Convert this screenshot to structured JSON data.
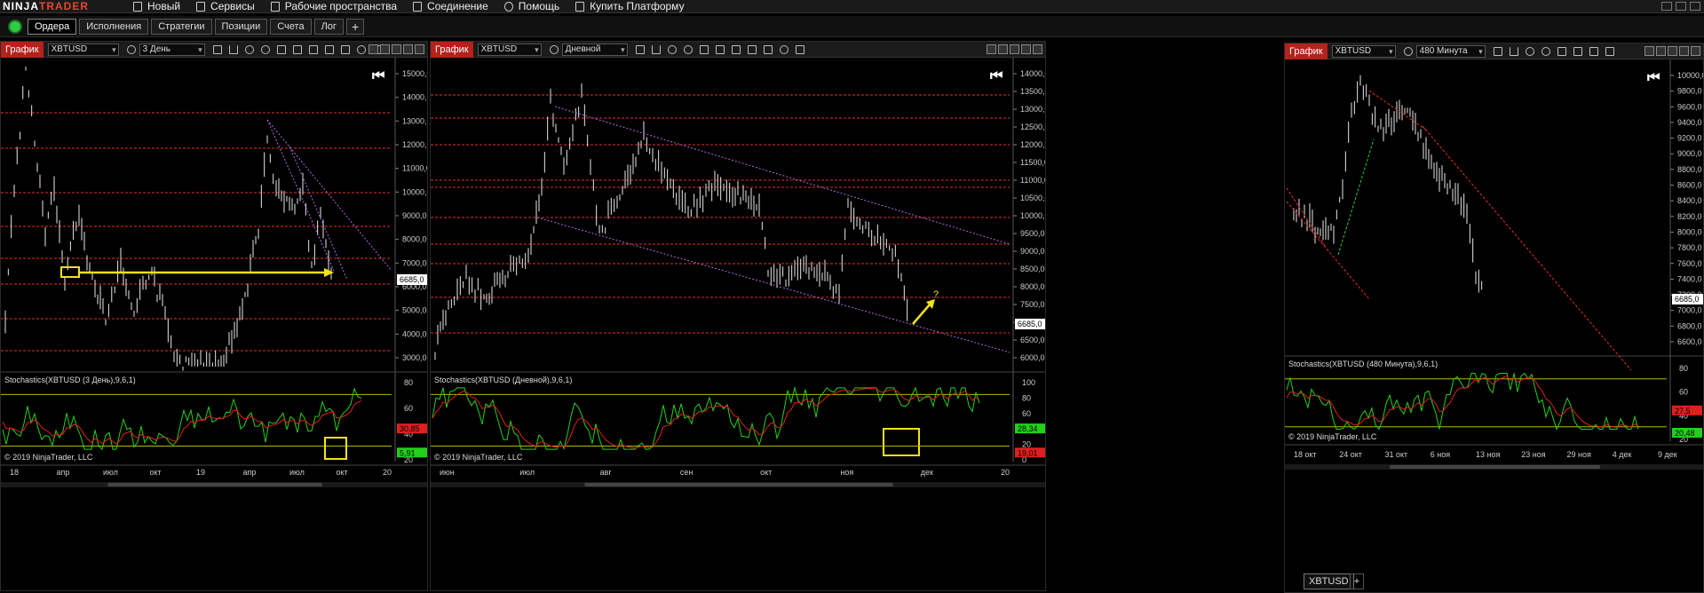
{
  "menu": {
    "logo_a": "NINJA",
    "logo_b": "TRADER",
    "items": [
      "Новый",
      "Сервисы",
      "Рабочие пространства",
      "Соединение",
      "Помощь",
      "Купить Платформу"
    ]
  },
  "tabs": [
    "Ордера",
    "Исполнения",
    "Стратегии",
    "Позиции",
    "Счета",
    "Лог"
  ],
  "add_tab": "+",
  "charts": [
    {
      "title": "График",
      "instrument": "XBTUSD",
      "period": "3 День",
      "price_label": "6685,0",
      "price_ticks": [
        "15000,0",
        "14000,0",
        "13000,0",
        "12000,0",
        "11000,0",
        "10000,0",
        "9000,0",
        "8000,0",
        "7000,0",
        "6000,0",
        "5000,0",
        "4000,0",
        "3000,0"
      ],
      "indicator_title": "Stochastics(XBTUSD (3 День),9,6,1)",
      "ind_ticks": [
        "80",
        "60",
        "40",
        "20"
      ],
      "ind_val_1": "30,85",
      "ind_val_2": "5,91",
      "copyright": "© 2019 NinjaTrader, LLC",
      "date_ticks": [
        "18",
        "апр",
        "июл",
        "окт",
        "19",
        "апр",
        "июл",
        "окт",
        "20"
      ]
    },
    {
      "title": "График",
      "instrument": "XBTUSD",
      "period": "Дневной",
      "price_label": "6685,0",
      "price_ticks": [
        "14000,0",
        "13500,0",
        "13000,0",
        "12500,0",
        "12000,0",
        "11500,0",
        "11000,0",
        "10500,0",
        "10000,0",
        "9500,0",
        "9000,0",
        "8500,0",
        "8000,0",
        "7500,0",
        "7000,0",
        "6500,0",
        "6000,0"
      ],
      "indicator_title": "Stochastics(XBTUSD (Дневной),9,6,1)",
      "ind_ticks": [
        "100",
        "80",
        "60",
        "40",
        "20",
        "0"
      ],
      "ind_val_1": "28,34",
      "ind_val_2": "19,01",
      "copyright": "© 2019 NinjaTrader, LLC",
      "date_ticks": [
        "июн",
        "июл",
        "авг",
        "сен",
        "окт",
        "ноя",
        "дек",
        "20"
      ],
      "annotation": "?"
    },
    {
      "title": "График",
      "instrument": "XBTUSD",
      "period": "480 Минута",
      "price_label": "6685,0",
      "price_ticks": [
        "10000,0",
        "9800,0",
        "9600,0",
        "9400,0",
        "9200,0",
        "9000,0",
        "8800,0",
        "8600,0",
        "8400,0",
        "8200,0",
        "8000,0",
        "7800,0",
        "7600,0",
        "7400,0",
        "7200,0",
        "7000,0",
        "6800,0",
        "6600,0"
      ],
      "indicator_title": "Stochastics(XBTUSD (480 Минута),9,6,1)",
      "ind_ticks": [
        "80",
        "60",
        "40",
        "20"
      ],
      "ind_val_1": "27,5",
      "ind_val_2": "20,48",
      "copyright": "© 2019 NinjaTrader, LLC",
      "date_ticks": [
        "18 окт",
        "24 окт",
        "31 окт",
        "6 ноя",
        "13 ноя",
        "23 ноя",
        "29 ноя",
        "4 дек",
        "9 дек"
      ]
    }
  ],
  "bottom_tab": "XBTUSD",
  "colors": {
    "background": "#000000",
    "title_red": "#b3221b",
    "grid_red": "#e0322a",
    "candle": "#e8e8e8",
    "stoch_green": "#22d11a",
    "stoch_red": "#e01f1f",
    "highlight_yellow": "#f2e21a",
    "trend_violet": "#b36be0",
    "price_label_bg": "#ffffff"
  }
}
